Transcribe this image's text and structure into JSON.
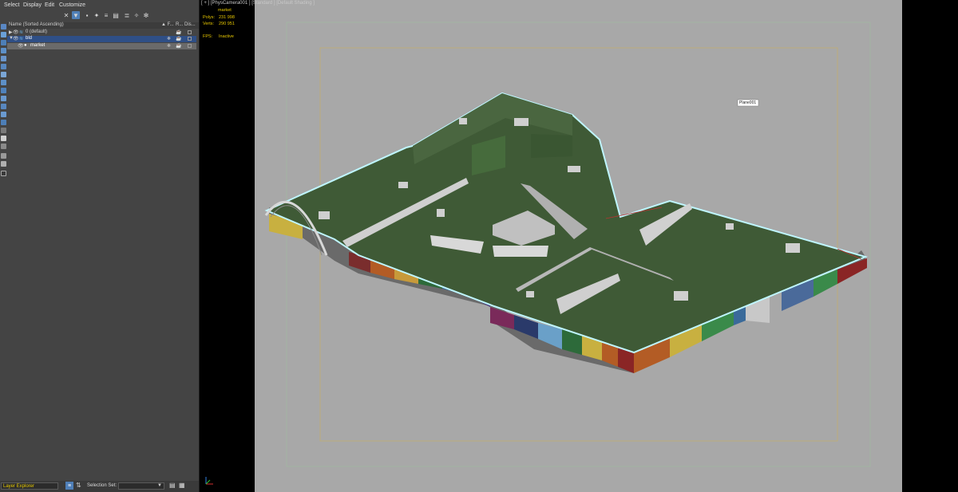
{
  "menu": [
    "Select",
    "Display",
    "Edit",
    "Customize"
  ],
  "explorer": {
    "header": {
      "name": "Name (Sorted Ascending)",
      "col_f": "▲ F...",
      "col_r": "R...",
      "col_dis": "Dis..."
    },
    "rows": [
      {
        "label": "0 (default)"
      },
      {
        "label": "bld"
      },
      {
        "label": "market"
      }
    ]
  },
  "status": {
    "layer_explorer": "Layer Explorer",
    "selection_set_label": "Selection Set:"
  },
  "viewport": {
    "label": "[ + ] [PhysCamera001 ] [Standard ] [Default Shading ]",
    "selected_object": "market",
    "polys_label": "Polys:",
    "polys_value": "231 998",
    "verts_label": "Verts:",
    "verts_value": "290 951",
    "fps_label": "FPS:",
    "fps_value": "Inactive",
    "object_tag": "Plane001"
  },
  "colors": {
    "accent": "#4f7fb8",
    "stats_yellow": "#e8c800",
    "roof_green": "#3f5a36",
    "viewport_bg": "#a8a8a8",
    "selection_outline": "#bff6ff"
  }
}
